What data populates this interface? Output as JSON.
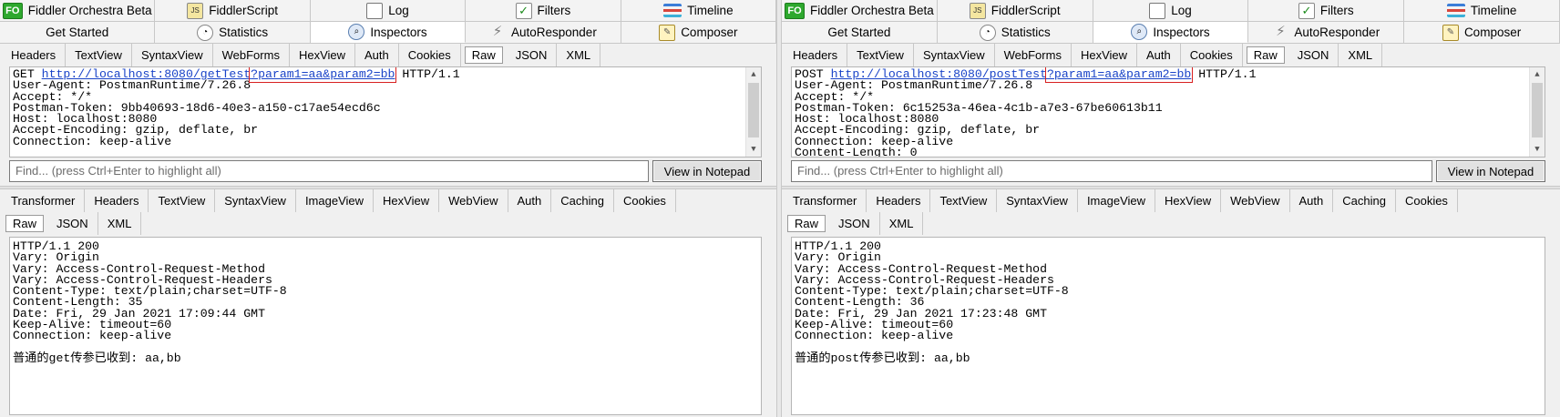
{
  "left": {
    "tabs_row1": [
      {
        "icon": "fiddler-orchestra-icon",
        "label": "Fiddler Orchestra Beta"
      },
      {
        "icon": "fiddlerscript-icon",
        "label": "FiddlerScript"
      },
      {
        "icon": "log-icon",
        "label": "Log"
      },
      {
        "icon": "filters-checkbox-icon",
        "label": "Filters"
      },
      {
        "icon": "timeline-icon",
        "label": "Timeline"
      }
    ],
    "tabs_row2": [
      {
        "icon": "",
        "label": "Get Started"
      },
      {
        "icon": "statistics-icon",
        "label": "Statistics"
      },
      {
        "icon": "inspectors-icon",
        "label": "Inspectors",
        "active": true
      },
      {
        "icon": "autoresponder-icon",
        "label": "AutoResponder"
      },
      {
        "icon": "composer-icon",
        "label": "Composer"
      }
    ],
    "request_tabs": [
      "Headers",
      "TextView",
      "SyntaxView",
      "WebForms",
      "HexView",
      "Auth",
      "Cookies",
      "Raw",
      "JSON",
      "XML"
    ],
    "request_selected": "Raw",
    "request": {
      "method": "GET",
      "url_base": "http://localhost:8080/getTest",
      "url_query": "?param1=aa&param2=bb",
      "protocol": "HTTP/1.1",
      "lines": [
        "User-Agent: PostmanRuntime/7.26.8",
        "Accept: */*",
        "Postman-Token: 9bb40693-18d6-40e3-a150-c17ae54ecd6c",
        "Host: localhost:8080",
        "Accept-Encoding: gzip, deflate, br",
        "Connection: keep-alive"
      ]
    },
    "find_placeholder": "Find... (press Ctrl+Enter to highlight all)",
    "view_notepad": "View in Notepad",
    "response_tabs": [
      "Transformer",
      "Headers",
      "TextView",
      "SyntaxView",
      "ImageView",
      "HexView",
      "WebView",
      "Auth",
      "Caching",
      "Cookies"
    ],
    "response_subtabs": [
      "Raw",
      "JSON",
      "XML"
    ],
    "response_selected": "Raw",
    "response_lines": [
      "HTTP/1.1 200",
      "Vary: Origin",
      "Vary: Access-Control-Request-Method",
      "Vary: Access-Control-Request-Headers",
      "Content-Type: text/plain;charset=UTF-8",
      "Content-Length: 35",
      "Date: Fri, 29 Jan 2021 17:09:44 GMT",
      "Keep-Alive: timeout=60",
      "Connection: keep-alive",
      "",
      "普通的get传参已收到: aa,bb"
    ]
  },
  "right": {
    "tabs_row1": [
      {
        "icon": "fiddler-orchestra-icon",
        "label": "Fiddler Orchestra Beta"
      },
      {
        "icon": "fiddlerscript-icon",
        "label": "FiddlerScript"
      },
      {
        "icon": "log-icon",
        "label": "Log"
      },
      {
        "icon": "filters-checkbox-icon",
        "label": "Filters"
      },
      {
        "icon": "timeline-icon",
        "label": "Timeline"
      }
    ],
    "tabs_row2": [
      {
        "icon": "",
        "label": "Get Started"
      },
      {
        "icon": "statistics-icon",
        "label": "Statistics"
      },
      {
        "icon": "inspectors-icon",
        "label": "Inspectors",
        "active": true
      },
      {
        "icon": "autoresponder-icon",
        "label": "AutoResponder"
      },
      {
        "icon": "composer-icon",
        "label": "Composer"
      }
    ],
    "request_tabs": [
      "Headers",
      "TextView",
      "SyntaxView",
      "WebForms",
      "HexView",
      "Auth",
      "Cookies",
      "Raw",
      "JSON",
      "XML"
    ],
    "request_selected": "Raw",
    "request": {
      "method": "POST",
      "url_base": "http://localhost:8080/postTest",
      "url_query": "?param1=aa&param2=bb",
      "protocol": "HTTP/1.1",
      "lines": [
        "User-Agent: PostmanRuntime/7.26.8",
        "Accept: */*",
        "Postman-Token: 6c15253a-46ea-4c1b-a7e3-67be60613b11",
        "Host: localhost:8080",
        "Accept-Encoding: gzip, deflate, br",
        "Connection: keep-alive",
        "Content-Length: 0"
      ]
    },
    "find_placeholder": "Find... (press Ctrl+Enter to highlight all)",
    "view_notepad": "View in Notepad",
    "response_tabs": [
      "Transformer",
      "Headers",
      "TextView",
      "SyntaxView",
      "ImageView",
      "HexView",
      "WebView",
      "Auth",
      "Caching",
      "Cookies"
    ],
    "response_subtabs": [
      "Raw",
      "JSON",
      "XML"
    ],
    "response_selected": "Raw",
    "response_lines": [
      "HTTP/1.1 200",
      "Vary: Origin",
      "Vary: Access-Control-Request-Method",
      "Vary: Access-Control-Request-Headers",
      "Content-Type: text/plain;charset=UTF-8",
      "Content-Length: 36",
      "Date: Fri, 29 Jan 2021 17:23:48 GMT",
      "Keep-Alive: timeout=60",
      "Connection: keep-alive",
      "",
      "普通的post传参已收到: aa,bb"
    ]
  },
  "colors": {
    "link": "#1a44c8",
    "highlight_box": "#d82020",
    "orchestra_green": "#2ea82e"
  }
}
